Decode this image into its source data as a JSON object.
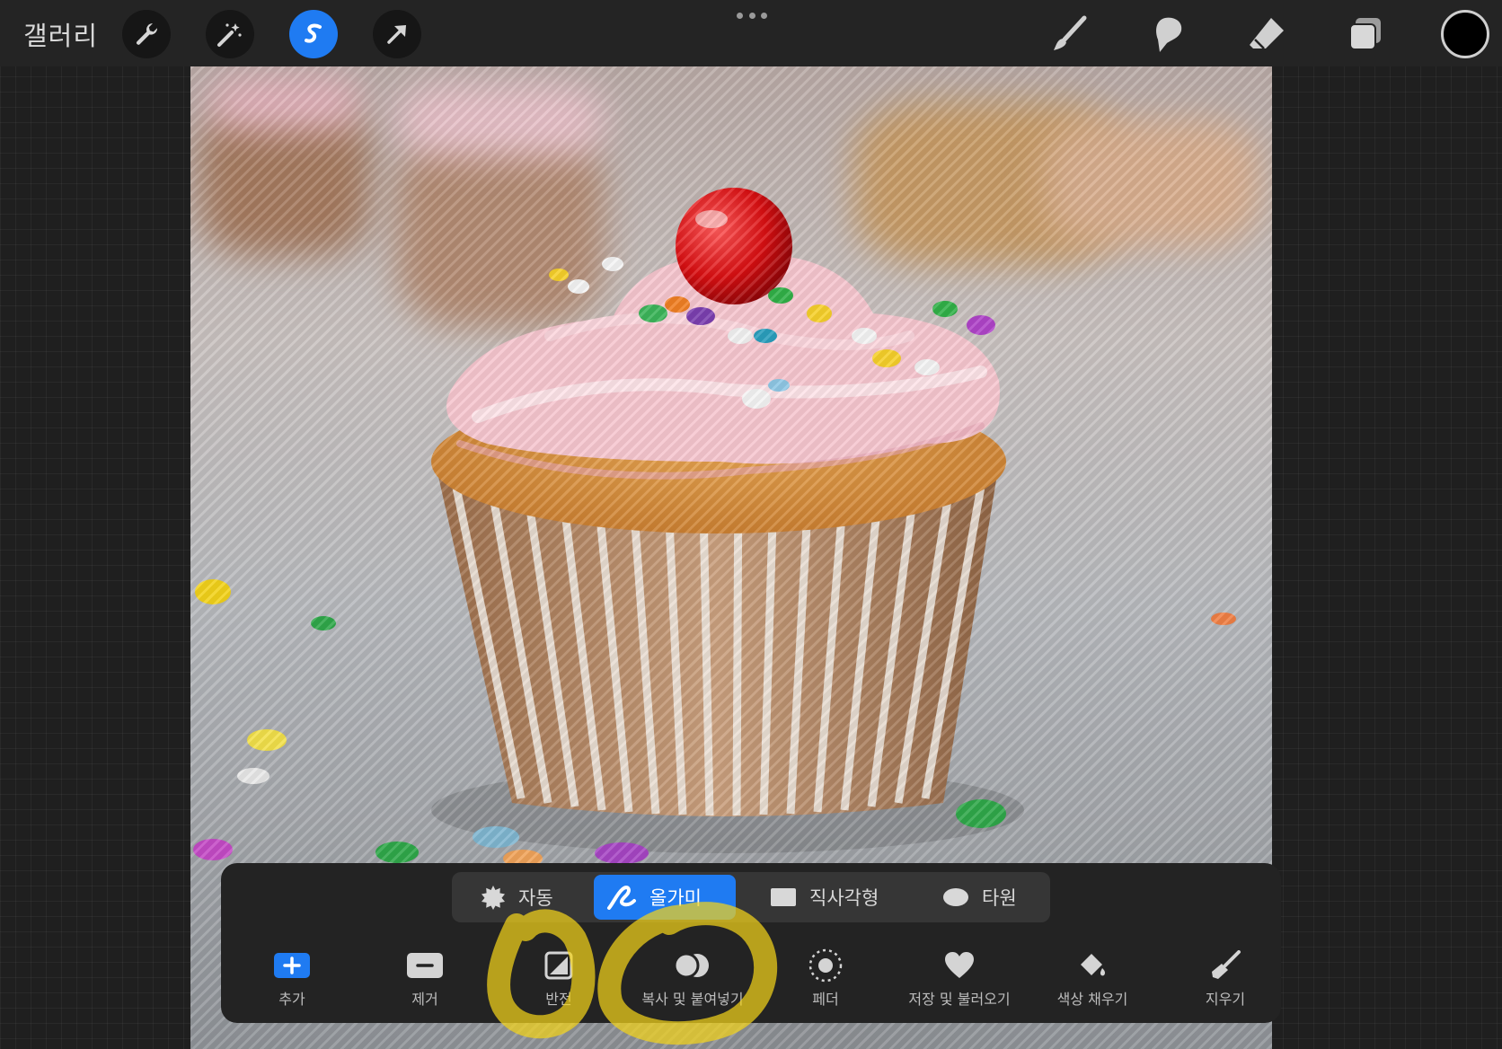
{
  "topbar": {
    "gallery_label": "갤러리",
    "tools_left": [
      "wrench-icon",
      "magic-wand-icon",
      "selection-s-icon",
      "move-arrow-icon"
    ],
    "active_tool": "selection-s-icon",
    "tools_right": [
      "brush-icon",
      "smudge-icon",
      "eraser-icon",
      "layers-icon"
    ],
    "current_color": "#000000"
  },
  "selection_panel": {
    "modes": [
      {
        "label": "자동",
        "icon": "starburst-icon"
      },
      {
        "label": "올가미",
        "icon": "lasso-icon"
      },
      {
        "label": "직사각형",
        "icon": "rectangle-icon"
      },
      {
        "label": "타원",
        "icon": "ellipse-icon"
      }
    ],
    "active_mode": "올가미",
    "actions": [
      {
        "label": "추가",
        "icon": "plus-square-icon"
      },
      {
        "label": "제거",
        "icon": "minus-square-icon"
      },
      {
        "label": "반전",
        "icon": "invert-square-icon"
      },
      {
        "label": "복사 및 붙여넣기",
        "icon": "copy-paste-icon"
      },
      {
        "label": "페더",
        "icon": "feather-dotted-circle-icon"
      },
      {
        "label": "저장 및 불러오기",
        "icon": "heart-icon"
      },
      {
        "label": "색상 채우기",
        "icon": "fill-drop-icon"
      },
      {
        "label": "지우기",
        "icon": "clear-broom-icon"
      }
    ]
  },
  "colors": {
    "accent": "#1f7bf2",
    "annotation": "#f2d21a"
  }
}
